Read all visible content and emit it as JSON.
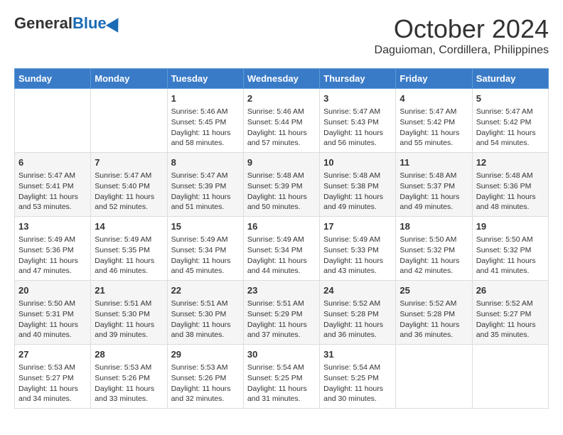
{
  "header": {
    "logo_general": "General",
    "logo_blue": "Blue",
    "month_title": "October 2024",
    "location": "Daguioman, Cordillera, Philippines"
  },
  "weekdays": [
    "Sunday",
    "Monday",
    "Tuesday",
    "Wednesday",
    "Thursday",
    "Friday",
    "Saturday"
  ],
  "weeks": [
    [
      null,
      null,
      {
        "day": "1",
        "sunrise": "Sunrise: 5:46 AM",
        "sunset": "Sunset: 5:45 PM",
        "daylight": "Daylight: 11 hours and 58 minutes."
      },
      {
        "day": "2",
        "sunrise": "Sunrise: 5:46 AM",
        "sunset": "Sunset: 5:44 PM",
        "daylight": "Daylight: 11 hours and 57 minutes."
      },
      {
        "day": "3",
        "sunrise": "Sunrise: 5:47 AM",
        "sunset": "Sunset: 5:43 PM",
        "daylight": "Daylight: 11 hours and 56 minutes."
      },
      {
        "day": "4",
        "sunrise": "Sunrise: 5:47 AM",
        "sunset": "Sunset: 5:42 PM",
        "daylight": "Daylight: 11 hours and 55 minutes."
      },
      {
        "day": "5",
        "sunrise": "Sunrise: 5:47 AM",
        "sunset": "Sunset: 5:42 PM",
        "daylight": "Daylight: 11 hours and 54 minutes."
      }
    ],
    [
      {
        "day": "6",
        "sunrise": "Sunrise: 5:47 AM",
        "sunset": "Sunset: 5:41 PM",
        "daylight": "Daylight: 11 hours and 53 minutes."
      },
      {
        "day": "7",
        "sunrise": "Sunrise: 5:47 AM",
        "sunset": "Sunset: 5:40 PM",
        "daylight": "Daylight: 11 hours and 52 minutes."
      },
      {
        "day": "8",
        "sunrise": "Sunrise: 5:47 AM",
        "sunset": "Sunset: 5:39 PM",
        "daylight": "Daylight: 11 hours and 51 minutes."
      },
      {
        "day": "9",
        "sunrise": "Sunrise: 5:48 AM",
        "sunset": "Sunset: 5:39 PM",
        "daylight": "Daylight: 11 hours and 50 minutes."
      },
      {
        "day": "10",
        "sunrise": "Sunrise: 5:48 AM",
        "sunset": "Sunset: 5:38 PM",
        "daylight": "Daylight: 11 hours and 49 minutes."
      },
      {
        "day": "11",
        "sunrise": "Sunrise: 5:48 AM",
        "sunset": "Sunset: 5:37 PM",
        "daylight": "Daylight: 11 hours and 49 minutes."
      },
      {
        "day": "12",
        "sunrise": "Sunrise: 5:48 AM",
        "sunset": "Sunset: 5:36 PM",
        "daylight": "Daylight: 11 hours and 48 minutes."
      }
    ],
    [
      {
        "day": "13",
        "sunrise": "Sunrise: 5:49 AM",
        "sunset": "Sunset: 5:36 PM",
        "daylight": "Daylight: 11 hours and 47 minutes."
      },
      {
        "day": "14",
        "sunrise": "Sunrise: 5:49 AM",
        "sunset": "Sunset: 5:35 PM",
        "daylight": "Daylight: 11 hours and 46 minutes."
      },
      {
        "day": "15",
        "sunrise": "Sunrise: 5:49 AM",
        "sunset": "Sunset: 5:34 PM",
        "daylight": "Daylight: 11 hours and 45 minutes."
      },
      {
        "day": "16",
        "sunrise": "Sunrise: 5:49 AM",
        "sunset": "Sunset: 5:34 PM",
        "daylight": "Daylight: 11 hours and 44 minutes."
      },
      {
        "day": "17",
        "sunrise": "Sunrise: 5:49 AM",
        "sunset": "Sunset: 5:33 PM",
        "daylight": "Daylight: 11 hours and 43 minutes."
      },
      {
        "day": "18",
        "sunrise": "Sunrise: 5:50 AM",
        "sunset": "Sunset: 5:32 PM",
        "daylight": "Daylight: 11 hours and 42 minutes."
      },
      {
        "day": "19",
        "sunrise": "Sunrise: 5:50 AM",
        "sunset": "Sunset: 5:32 PM",
        "daylight": "Daylight: 11 hours and 41 minutes."
      }
    ],
    [
      {
        "day": "20",
        "sunrise": "Sunrise: 5:50 AM",
        "sunset": "Sunset: 5:31 PM",
        "daylight": "Daylight: 11 hours and 40 minutes."
      },
      {
        "day": "21",
        "sunrise": "Sunrise: 5:51 AM",
        "sunset": "Sunset: 5:30 PM",
        "daylight": "Daylight: 11 hours and 39 minutes."
      },
      {
        "day": "22",
        "sunrise": "Sunrise: 5:51 AM",
        "sunset": "Sunset: 5:30 PM",
        "daylight": "Daylight: 11 hours and 38 minutes."
      },
      {
        "day": "23",
        "sunrise": "Sunrise: 5:51 AM",
        "sunset": "Sunset: 5:29 PM",
        "daylight": "Daylight: 11 hours and 37 minutes."
      },
      {
        "day": "24",
        "sunrise": "Sunrise: 5:52 AM",
        "sunset": "Sunset: 5:28 PM",
        "daylight": "Daylight: 11 hours and 36 minutes."
      },
      {
        "day": "25",
        "sunrise": "Sunrise: 5:52 AM",
        "sunset": "Sunset: 5:28 PM",
        "daylight": "Daylight: 11 hours and 36 minutes."
      },
      {
        "day": "26",
        "sunrise": "Sunrise: 5:52 AM",
        "sunset": "Sunset: 5:27 PM",
        "daylight": "Daylight: 11 hours and 35 minutes."
      }
    ],
    [
      {
        "day": "27",
        "sunrise": "Sunrise: 5:53 AM",
        "sunset": "Sunset: 5:27 PM",
        "daylight": "Daylight: 11 hours and 34 minutes."
      },
      {
        "day": "28",
        "sunrise": "Sunrise: 5:53 AM",
        "sunset": "Sunset: 5:26 PM",
        "daylight": "Daylight: 11 hours and 33 minutes."
      },
      {
        "day": "29",
        "sunrise": "Sunrise: 5:53 AM",
        "sunset": "Sunset: 5:26 PM",
        "daylight": "Daylight: 11 hours and 32 minutes."
      },
      {
        "day": "30",
        "sunrise": "Sunrise: 5:54 AM",
        "sunset": "Sunset: 5:25 PM",
        "daylight": "Daylight: 11 hours and 31 minutes."
      },
      {
        "day": "31",
        "sunrise": "Sunrise: 5:54 AM",
        "sunset": "Sunset: 5:25 PM",
        "daylight": "Daylight: 11 hours and 30 minutes."
      },
      null,
      null
    ]
  ]
}
